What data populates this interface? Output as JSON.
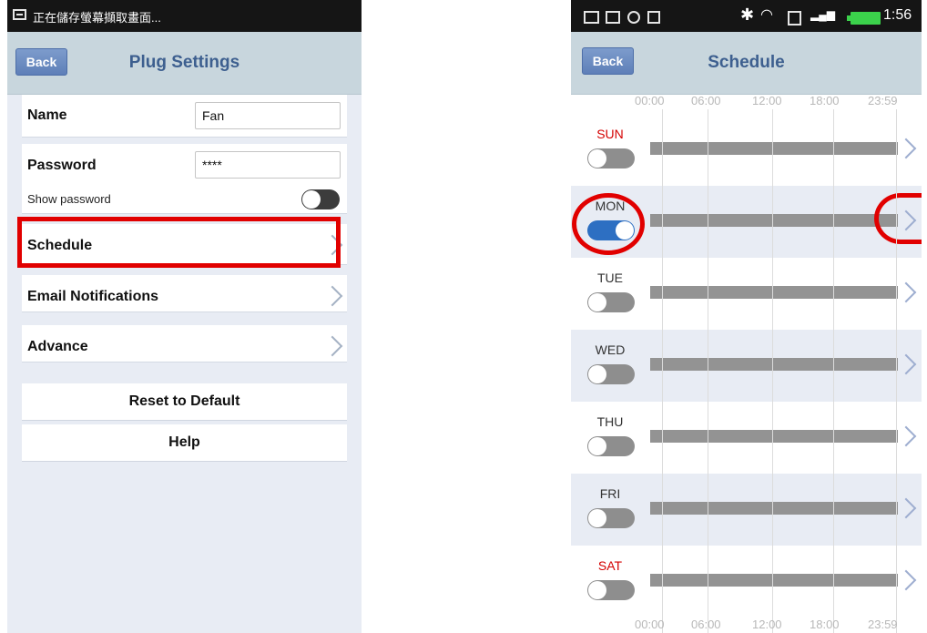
{
  "left": {
    "status_text": "正在儲存螢幕擷取畫面...",
    "back_label": "Back",
    "title": "Plug Settings",
    "name_label": "Name",
    "name_value": "Fan",
    "password_label": "Password",
    "password_value": "****",
    "show_password_label": "Show password",
    "show_password_on": false,
    "schedule_label": "Schedule",
    "email_label": "Email Notifications",
    "advance_label": "Advance",
    "reset_label": "Reset to Default",
    "help_label": "Help"
  },
  "right": {
    "clock": "1:56",
    "back_label": "Back",
    "title": "Schedule",
    "axis": [
      "00:00",
      "06:00",
      "12:00",
      "18:00",
      "23:59"
    ],
    "days": [
      {
        "name": "SUN",
        "on": false,
        "color": "#d40000"
      },
      {
        "name": "MON",
        "on": true,
        "color": "#333333"
      },
      {
        "name": "TUE",
        "on": false,
        "color": "#333333"
      },
      {
        "name": "WED",
        "on": false,
        "color": "#333333"
      },
      {
        "name": "THU",
        "on": false,
        "color": "#333333"
      },
      {
        "name": "FRI",
        "on": false,
        "color": "#333333"
      },
      {
        "name": "SAT",
        "on": false,
        "color": "#d40000"
      }
    ]
  },
  "colors": {
    "highlight": "#e10000",
    "accent": "#2d6fc2",
    "title_blue": "#3d5f8f"
  }
}
